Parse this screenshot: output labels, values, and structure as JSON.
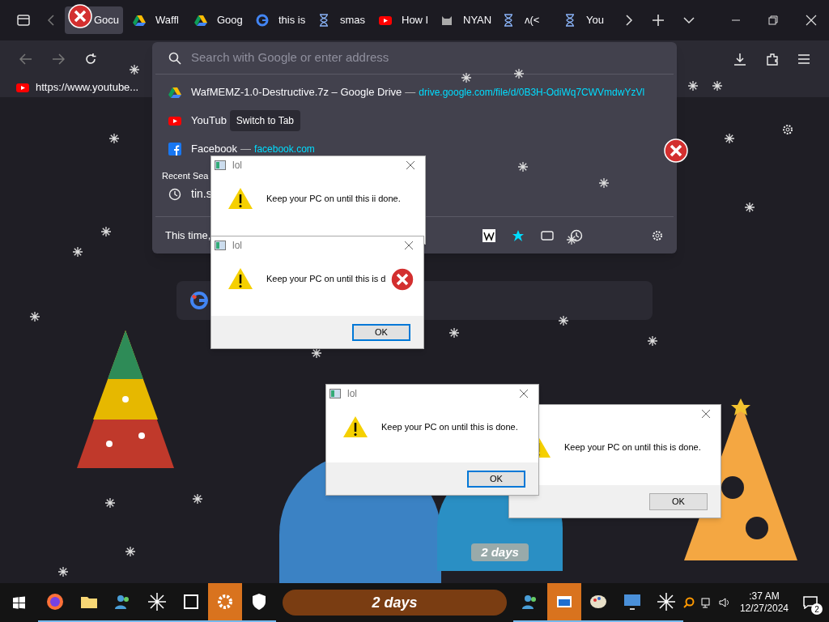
{
  "browser": {
    "tabs": [
      {
        "label": "Gocu",
        "kind": "generic",
        "selected": true
      },
      {
        "label": "Waffl",
        "kind": "drive",
        "selected": false
      },
      {
        "label": "Goog",
        "kind": "drive",
        "selected": false
      },
      {
        "label": "this is",
        "kind": "google",
        "selected": false
      },
      {
        "label": "smas",
        "kind": "hourglass",
        "selected": false
      },
      {
        "label": "How I",
        "kind": "youtube",
        "selected": false
      },
      {
        "label": "NYAN",
        "kind": "cat",
        "selected": false
      },
      {
        "label": "ʌ(<",
        "kind": "hourglass",
        "selected": false
      },
      {
        "label": "You",
        "kind": "hourglass",
        "selected": false
      }
    ],
    "bookmarks": [
      {
        "label": "https://www.youtube..."
      }
    ],
    "urlbar": {
      "placeholder": "Search with Google or enter address"
    },
    "suggestions": [
      {
        "kind": "drive",
        "title": "WafMEMZ-1.0-Destructive.7z – Google Drive",
        "separator": "—",
        "url": "drive.google.com/file/d/0B3H-OdiWq7CWVmdwYzVl"
      },
      {
        "kind": "youtube",
        "title": "YouTub",
        "action": "Switch to Tab"
      },
      {
        "kind": "facebook",
        "title": "Facebook",
        "separator": "—",
        "url": "facebook.com"
      }
    ],
    "recent_heading": "Recent Sea",
    "recent": [
      {
        "text": "tin.s"
      }
    ],
    "shortcuts_label": "This time,"
  },
  "dialogs": [
    {
      "title": "lol",
      "message": "Keep your PC on until this ii done."
    },
    {
      "title": "lol",
      "message": "Keep your PC on until this is d",
      "button": "OK",
      "default": true
    },
    {
      "message": "Keep your PC on until this is done.",
      "button": "OK",
      "default": false
    },
    {
      "title": "lol",
      "message": "Keep your PC on until this is done.",
      "button": "OK",
      "default": true
    }
  ],
  "globe_label": "2 days",
  "taskbar": {
    "apps": [
      {
        "kind": "firefox",
        "highlighted": false
      },
      {
        "kind": "folder",
        "highlighted": false
      },
      {
        "kind": "people",
        "highlighted": false
      },
      {
        "kind": "star",
        "highlighted": false
      },
      {
        "kind": "archive",
        "highlighted": false
      },
      {
        "kind": "gear",
        "highlighted": true
      },
      {
        "kind": "shield",
        "highlighted": false
      }
    ],
    "banner": "2 days",
    "apps_right": [
      {
        "kind": "people",
        "highlighted": false
      },
      {
        "kind": "window",
        "highlighted": true
      },
      {
        "kind": "palette",
        "highlighted": false
      },
      {
        "kind": "monitor",
        "highlighted": false
      },
      {
        "kind": "star",
        "highlighted": false
      }
    ],
    "time": ":37 AM",
    "date": "12/27/2024",
    "notifications": "2"
  }
}
